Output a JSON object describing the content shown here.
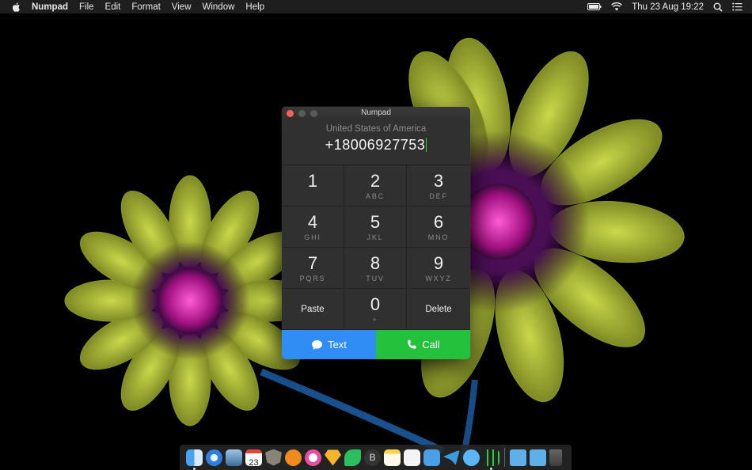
{
  "menubar": {
    "app_name": "Numpad",
    "menus": [
      "File",
      "Edit",
      "Format",
      "View",
      "Window",
      "Help"
    ],
    "clock": "Thu 23 Aug 19:22"
  },
  "window": {
    "title": "Numpad",
    "country": "United States of America",
    "number": "+18006927753",
    "keys": [
      {
        "digit": "1",
        "letters": ""
      },
      {
        "digit": "2",
        "letters": "ABC"
      },
      {
        "digit": "3",
        "letters": "DEF"
      },
      {
        "digit": "4",
        "letters": "GHI"
      },
      {
        "digit": "5",
        "letters": "JKL"
      },
      {
        "digit": "6",
        "letters": "MNO"
      },
      {
        "digit": "7",
        "letters": "PQRS"
      },
      {
        "digit": "8",
        "letters": "TUV"
      },
      {
        "digit": "9",
        "letters": "WXYZ"
      }
    ],
    "paste_label": "Paste",
    "zero": {
      "digit": "0",
      "letters": "+"
    },
    "delete_label": "Delete",
    "text_label": "Text",
    "call_label": "Call"
  },
  "colors": {
    "text_button": "#2f8df5",
    "call_button": "#24c13c",
    "close_light": "#fc605c"
  },
  "dock": {
    "icons": [
      "finder-icon",
      "safari-icon",
      "preview-icon",
      "calendar-icon",
      "security-icon",
      "books-icon",
      "itunes-icon",
      "sketch-icon",
      "evernote-icon",
      "bear-icon",
      "notes-icon",
      "reminders-icon",
      "tunnelbear-icon",
      "telegram-icon",
      "messages-icon",
      "numpad-icon",
      "folder-icon",
      "screenshots-folder-icon",
      "trash-icon"
    ]
  }
}
